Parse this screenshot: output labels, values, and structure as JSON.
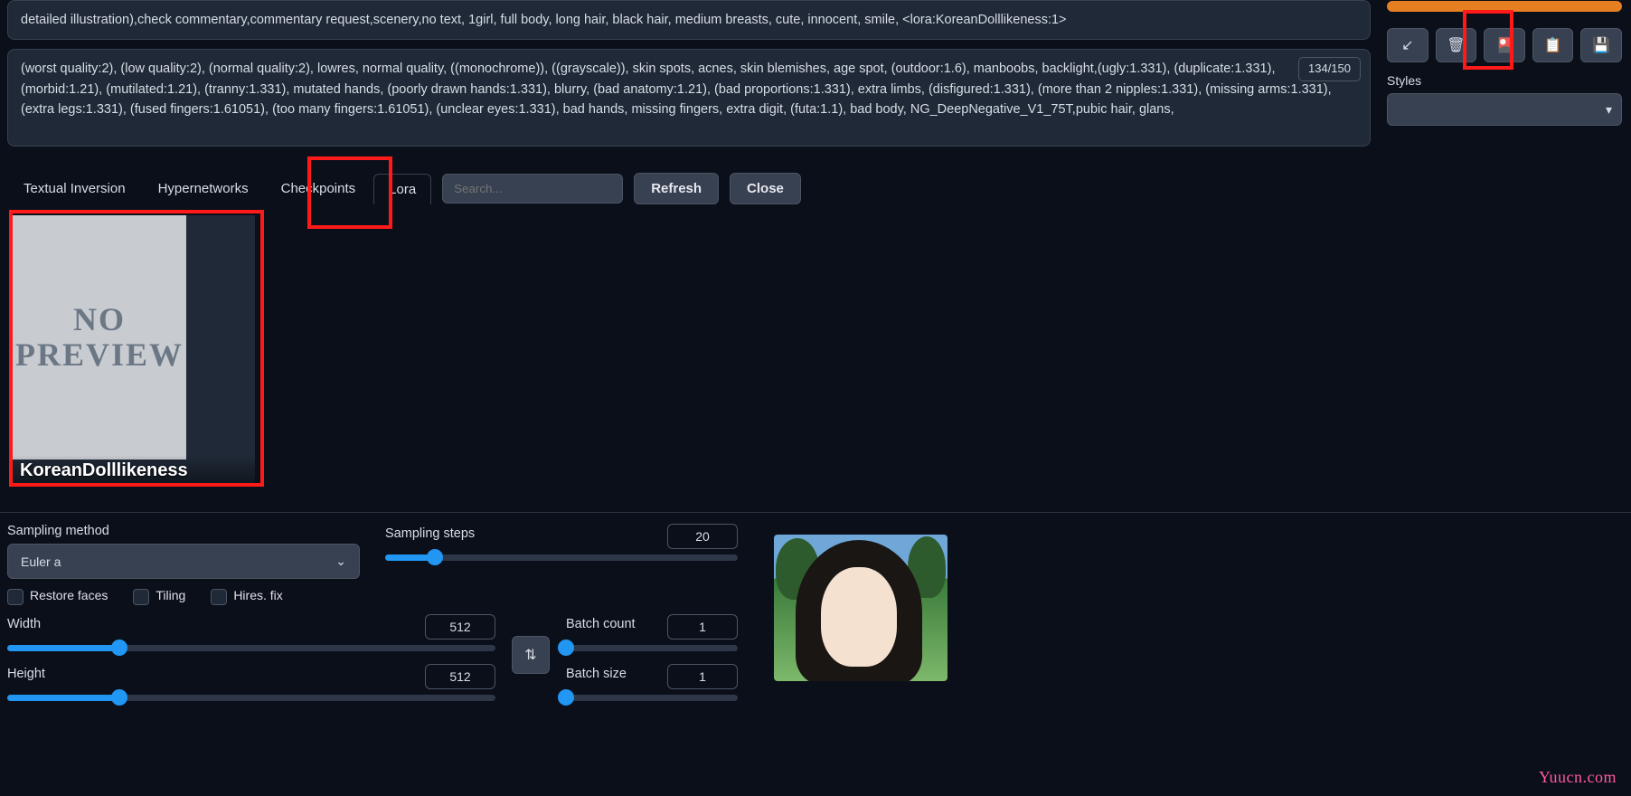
{
  "prompt": {
    "visible_text": "detailed illustration),check commentary,commentary request,scenery,no text, 1girl, full body, long hair, black hair, medium breasts, cute, innocent, smile, <lora:KoreanDolllikeness:1>"
  },
  "neg_prompt": {
    "token_count": "134/150",
    "text": "(worst quality:2), (low quality:2), (normal quality:2), lowres, normal quality, ((monochrome)), ((grayscale)), skin spots, acnes, skin blemishes, age spot, (outdoor:1.6), manboobs, backlight,(ugly:1.331), (duplicate:1.331), (morbid:1.21), (mutilated:1.21), (tranny:1.331), mutated hands, (poorly drawn hands:1.331), blurry, (bad anatomy:1.21), (bad proportions:1.331), extra limbs, (disfigured:1.331), (more than 2 nipples:1.331), (missing arms:1.331), (extra legs:1.331), (fused fingers:1.61051), (too many fingers:1.61051), (unclear eyes:1.331), bad hands, missing fingers, extra digit, (futa:1.1), bad body, NG_DeepNegative_V1_75T,pubic hair, glans,"
  },
  "right_panel": {
    "generate_label": "",
    "icons": [
      "↙",
      "🗑",
      "🎴",
      "📋",
      "💾"
    ],
    "styles_label": "Styles",
    "styles_caret": "▾"
  },
  "extra_networks": {
    "tabs": [
      "Textual Inversion",
      "Hypernetworks",
      "Checkpoints",
      "Lora"
    ],
    "active_tab": "Lora",
    "search_placeholder": "Search...",
    "refresh": "Refresh",
    "close": "Close",
    "card": {
      "no_preview_line1": "NO",
      "no_preview_line2": "PREVIEW",
      "label": "KoreanDolllikeness"
    }
  },
  "settings": {
    "sampling_method_label": "Sampling method",
    "sampling_method_value": "Euler a",
    "sampling_steps_label": "Sampling steps",
    "sampling_steps_value": "20",
    "restore_faces": "Restore faces",
    "tiling": "Tiling",
    "hires_fix": "Hires. fix",
    "width_label": "Width",
    "width_value": "512",
    "height_label": "Height",
    "height_value": "512",
    "swap_icon": "⇅",
    "batch_count_label": "Batch count",
    "batch_count_value": "1",
    "batch_size_label": "Batch size",
    "batch_size_value": "1"
  },
  "watermark": "Yuucn.com"
}
